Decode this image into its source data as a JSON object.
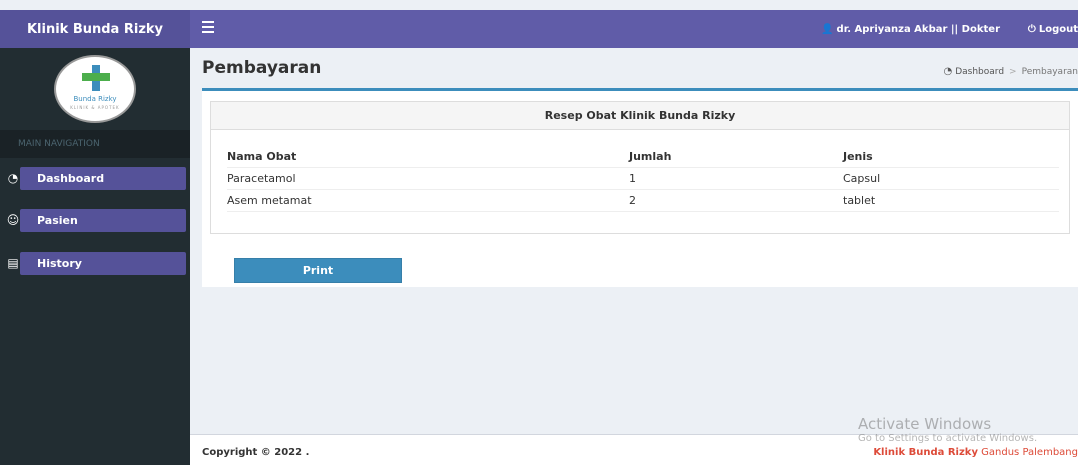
{
  "app": {
    "brand": "Klinik Bunda Rizky"
  },
  "logo": {
    "text": "Bunda Rizky",
    "subtext": "KLINIK & APOTEK"
  },
  "sidebar": {
    "header": "MAIN NAVIGATION",
    "items": [
      {
        "label": "Dashboard",
        "icon": "dashboard-icon"
      },
      {
        "label": "Pasien",
        "icon": "users-icon"
      },
      {
        "label": "History",
        "icon": "book-icon"
      }
    ]
  },
  "header": {
    "user": "dr. Apriyanza Akbar || Dokter",
    "logout": "Logout"
  },
  "content": {
    "title": "Pembayaran",
    "breadcrumb": [
      "Dashboard",
      "Pembayaran"
    ]
  },
  "box": {
    "title": "Resep Obat Klinik Bunda Rizky",
    "columns": [
      "Nama Obat",
      "Jumlah",
      "Jenis"
    ],
    "rows": [
      [
        "Paracetamol",
        "1",
        "Capsul"
      ],
      [
        "Asem metamat",
        "2",
        "tablet"
      ]
    ],
    "print_label": "Print"
  },
  "footer": {
    "copyright": "Copyright © 2022 .",
    "credit_brand": "Klinik Bunda Rizky",
    "credit_location": "Gandus Palembang"
  },
  "watermark": {
    "line1": "Activate Windows",
    "line2": "Go to Settings to activate Windows."
  },
  "colors": {
    "primary": "#605ca8",
    "sidebar": "#222d32",
    "accent": "#3c8dbc",
    "credit": "#dd4b39"
  }
}
